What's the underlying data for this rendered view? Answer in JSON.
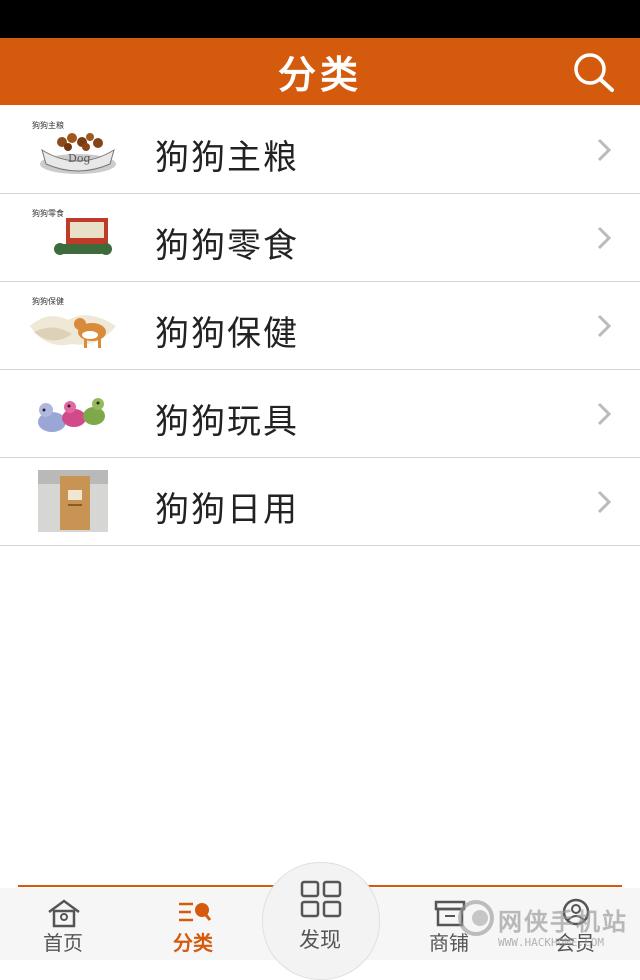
{
  "header": {
    "title": "分类"
  },
  "categories": [
    {
      "label": "狗狗主粮",
      "icon": "dog-food-bowl-image"
    },
    {
      "label": "狗狗零食",
      "icon": "dog-snack-image"
    },
    {
      "label": "狗狗保健",
      "icon": "dog-health-image"
    },
    {
      "label": "狗狗玩具",
      "icon": "dog-toy-image"
    },
    {
      "label": "狗狗日用",
      "icon": "dog-daily-bag-image"
    }
  ],
  "tabs": [
    {
      "label": "首页",
      "icon": "home-icon"
    },
    {
      "label": "分类",
      "icon": "category-icon",
      "active": true
    },
    {
      "label": "发现",
      "icon": "grid-icon"
    },
    {
      "label": "商铺",
      "icon": "shop-icon"
    },
    {
      "label": "会员",
      "icon": "user-icon"
    }
  ],
  "watermark": {
    "text": "网侠手机站",
    "url": "WWW.HACKHOME.COM"
  },
  "colors": {
    "accent": "#d45a0e",
    "status_bar": "#000000"
  }
}
